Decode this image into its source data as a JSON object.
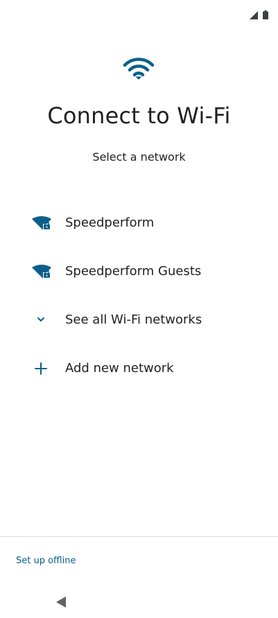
{
  "colors": {
    "accent": "#0b5f8a",
    "text": "#202124",
    "divider": "#dadce0",
    "nav": "#5f6368"
  },
  "status_bar": {
    "icons": [
      "signal-icon",
      "battery-icon"
    ]
  },
  "header": {
    "icon": "wifi-icon",
    "title": "Connect to Wi-Fi",
    "subtitle": "Select a network"
  },
  "networks": [
    {
      "name": "Speedperform",
      "icon": "wifi-lock-icon"
    },
    {
      "name": "Speedperform Guests",
      "icon": "wifi-lock-icon"
    }
  ],
  "actions": {
    "see_all": {
      "label": "See all Wi-Fi networks",
      "icon": "chevron-down-icon"
    },
    "add_network": {
      "label": "Add new network",
      "icon": "plus-icon"
    }
  },
  "footer": {
    "offline_label": "Set up offline"
  },
  "nav_bar": {
    "back_icon": "back-triangle-icon"
  }
}
